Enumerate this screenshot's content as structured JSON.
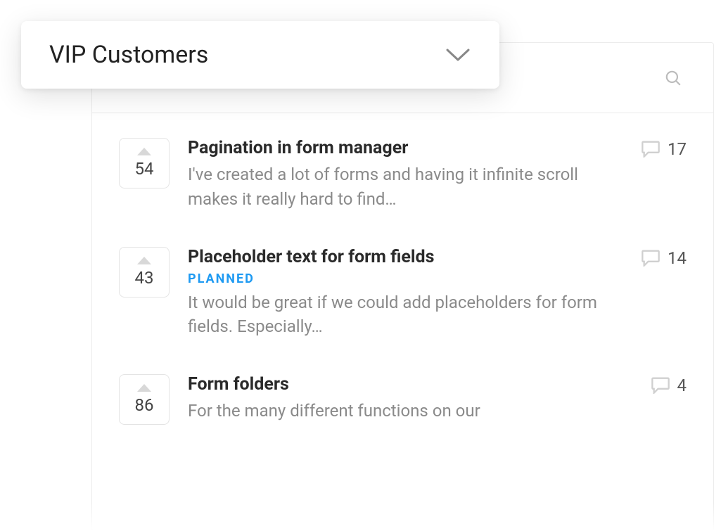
{
  "filter": {
    "selected": "VIP Customers"
  },
  "items": [
    {
      "votes": "54",
      "title": "Pagination in form manager",
      "status": "",
      "desc": "I've created a lot of forms and having it infinite scroll makes it really hard to find…",
      "comments": "17"
    },
    {
      "votes": "43",
      "title": "Placeholder text for form fields",
      "status": "PLANNED",
      "desc": "It would be great if we could add placeholders for form fields. Especially…",
      "comments": "14"
    },
    {
      "votes": "86",
      "title": "Form folders",
      "status": "",
      "desc": "For the many different functions on our",
      "comments": "4"
    }
  ]
}
